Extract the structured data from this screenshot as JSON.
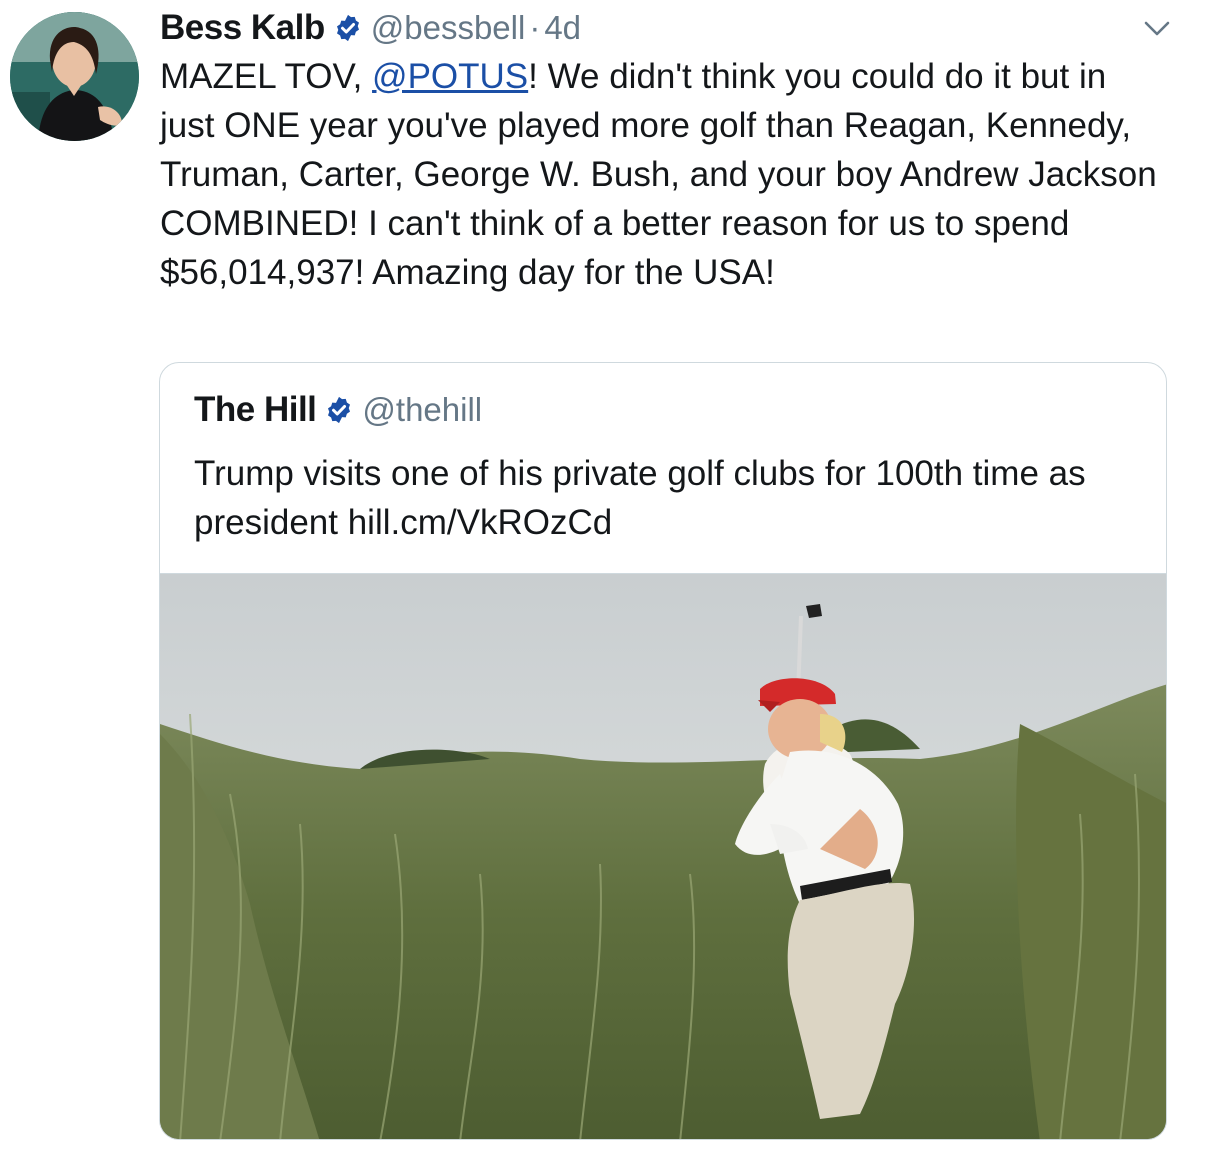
{
  "tweet": {
    "author_name": "Bess Kalb",
    "author_handle": "@bessbell",
    "separator": "·",
    "timestamp": "4d",
    "text_before_mention": "MAZEL TOV, ",
    "mention": "@POTUS",
    "text_after_mention": "! We didn't think you could do it but in just ONE year you've played more golf than Reagan, Kennedy, Truman, Carter, George W. Bush, and your boy Andrew Jackson COMBINED! I can't think of a better reason for us to spend $56,014,937! Amazing day for the USA!"
  },
  "quoted_tweet": {
    "author_name": "The Hill",
    "author_handle": "@thehill",
    "text": "Trump visits one of his private golf clubs for 100th time as president hill.cm/VkROzCd"
  },
  "icons": {
    "verified": "verified-badge-icon",
    "caret": "chevron-down-icon",
    "avatar": "avatar-photo",
    "media": "golf-photo"
  },
  "colors": {
    "verified_badge": "#1b4fa6",
    "mention": "#1b4fa6",
    "secondary_text": "#657786",
    "border": "#cfd9de"
  }
}
